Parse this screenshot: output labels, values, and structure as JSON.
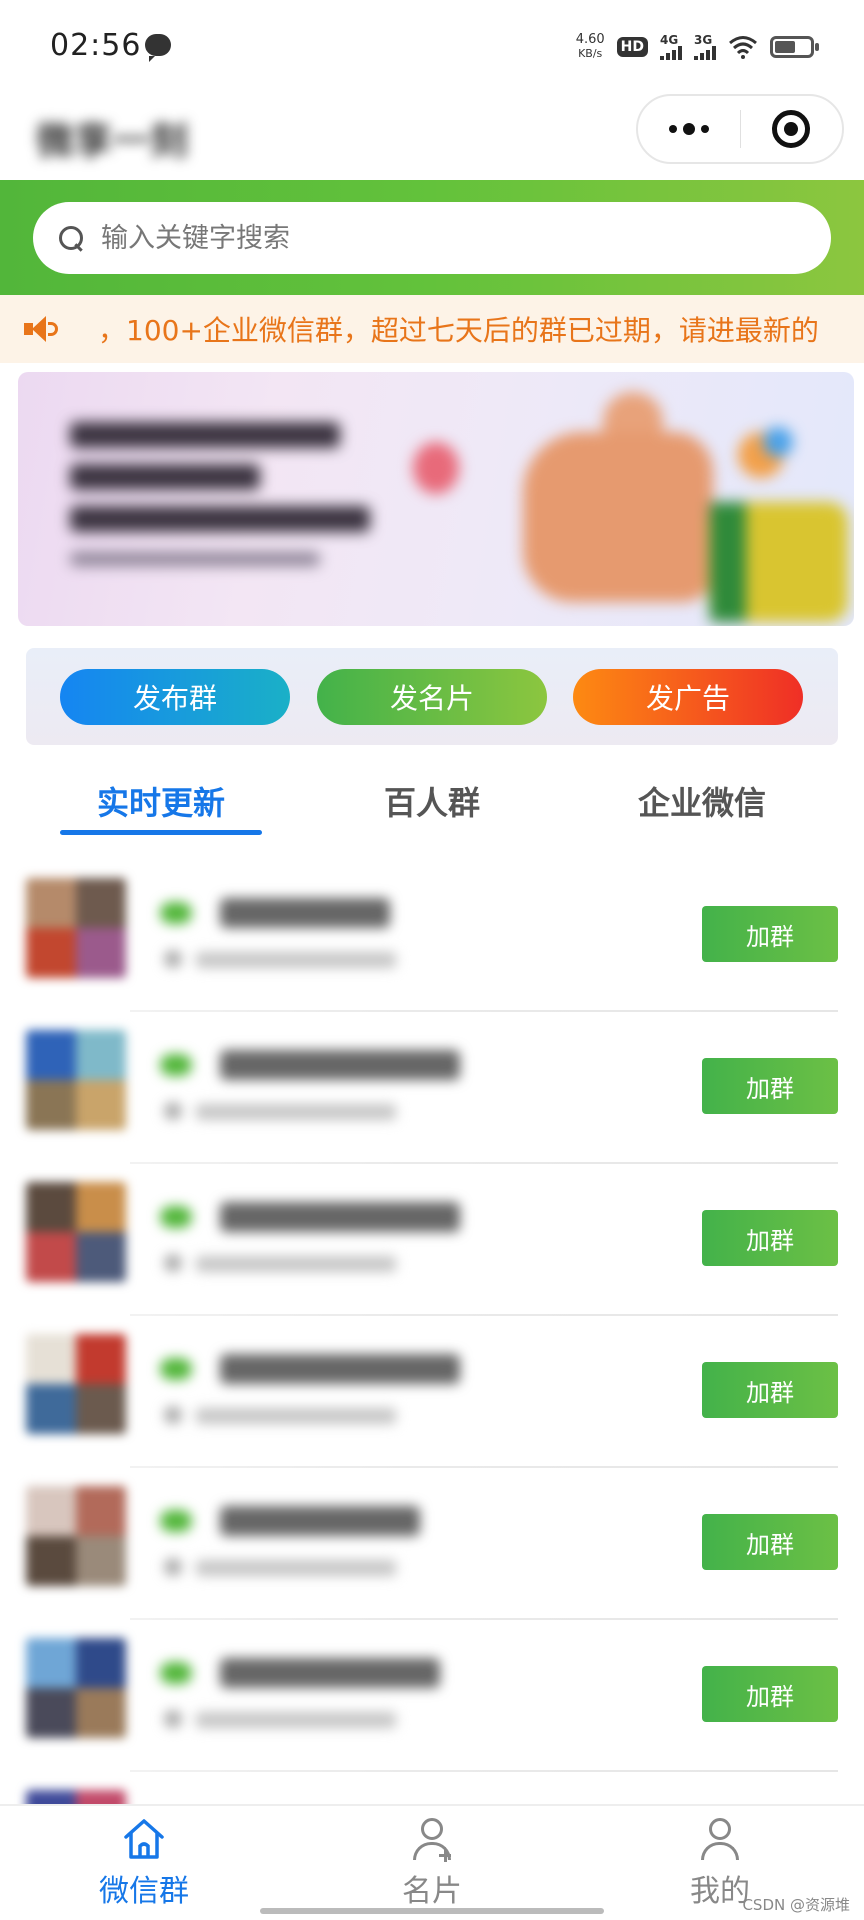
{
  "status_bar": {
    "time": "02:56",
    "net_speed_value": "4.60",
    "net_speed_unit": "KB/s",
    "hd_label": "HD",
    "sim1_label": "4G",
    "sim2_label": "3G",
    "battery_level": 0.6
  },
  "header": {
    "title": "微享一刻"
  },
  "search": {
    "placeholder": "输入关键字搜索"
  },
  "notice": {
    "text": "，100+企业微信群，超过七天后的群已过期，请进最新的"
  },
  "actions": {
    "publish_group": "发布群",
    "publish_card": "发名片",
    "publish_ad": "发广告"
  },
  "tabs": [
    "实时更新",
    "百人群",
    "企业微信"
  ],
  "group_list": {
    "join_label": "加群",
    "item_count_visible": 6
  },
  "tabbar": {
    "items": [
      {
        "label": "微信群",
        "icon": "home-icon",
        "active": true
      },
      {
        "label": "名片",
        "icon": "add-contact-icon",
        "active": false
      },
      {
        "label": "我的",
        "icon": "person-icon",
        "active": false
      }
    ]
  },
  "watermark": "CSDN @资源堆",
  "colors": {
    "brand_green": "#52b63a",
    "accent_blue": "#1677e8",
    "notice_orange": "#e8751a"
  }
}
